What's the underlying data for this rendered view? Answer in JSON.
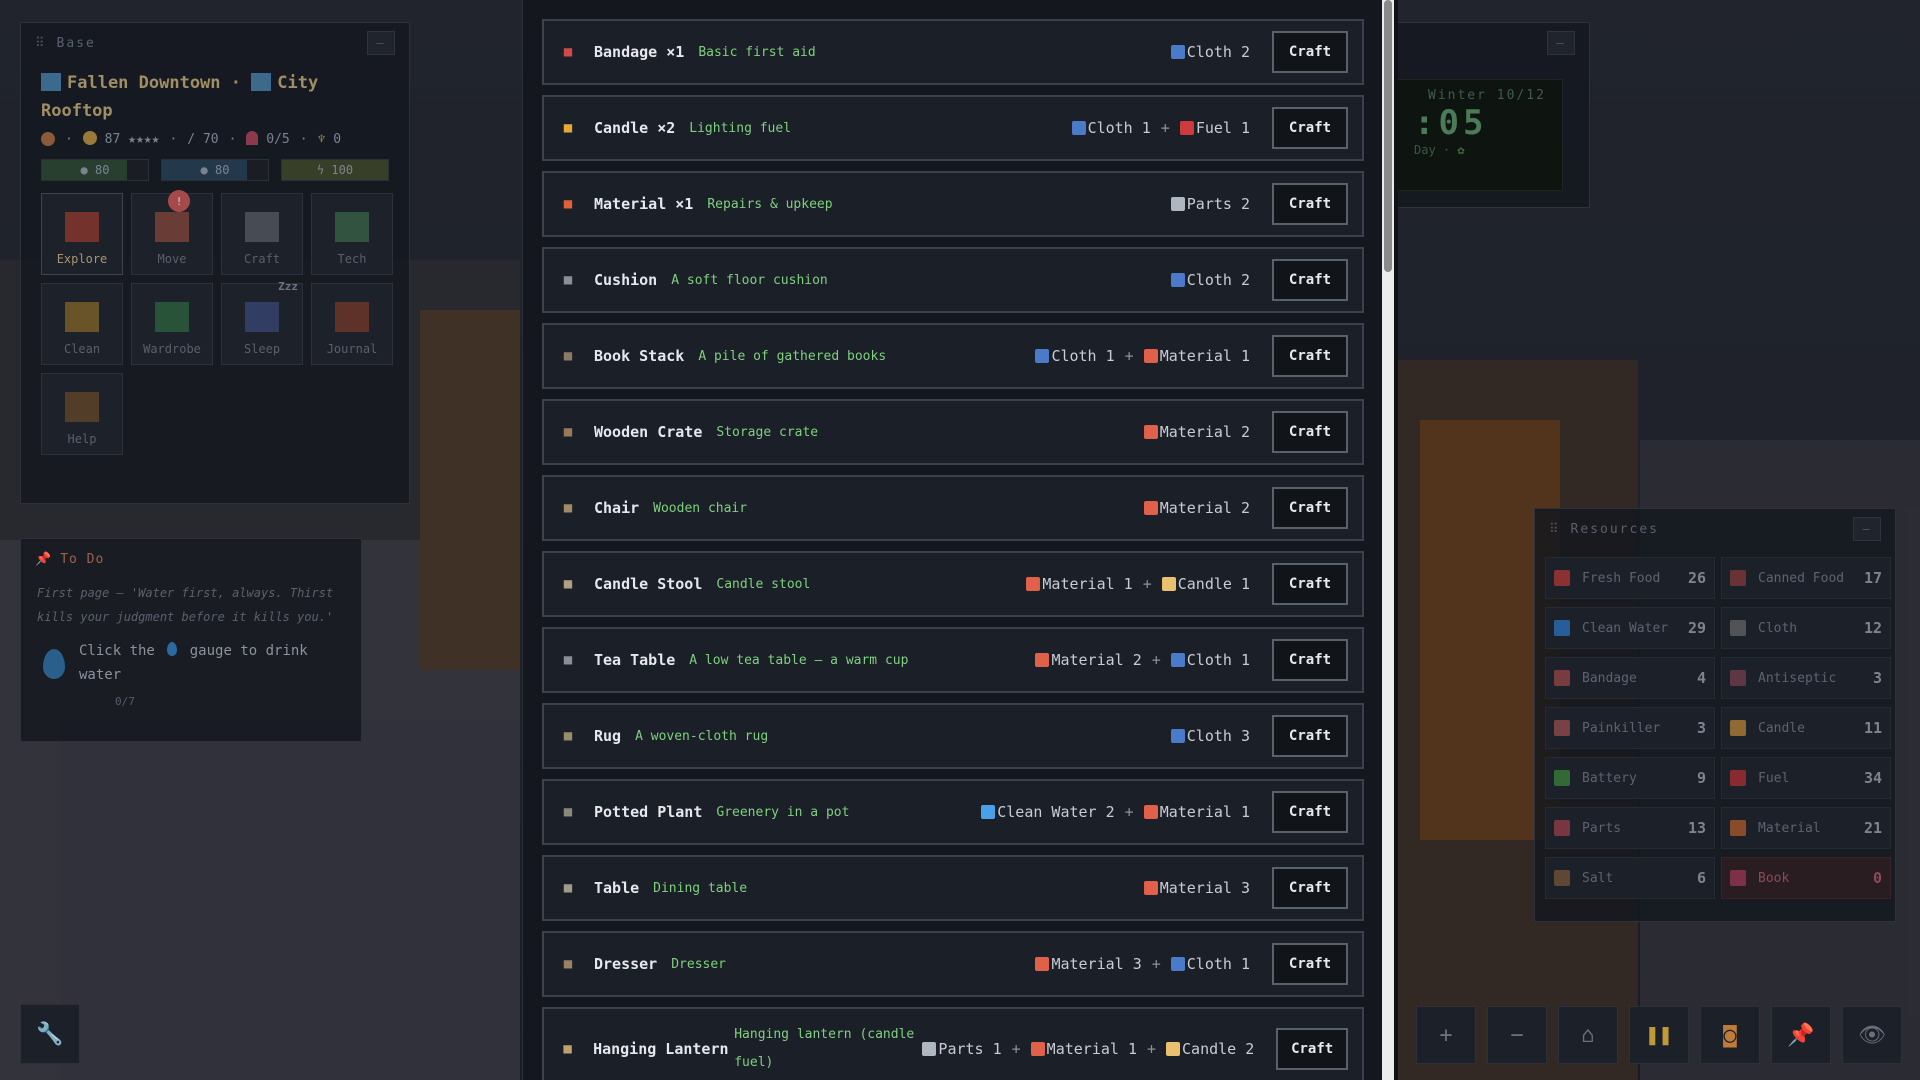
{
  "base": {
    "title": "Base",
    "minimize": "–",
    "location_line1": "Fallen Downtown · ",
    "location_city": "City",
    "location_line2": "Rooftop",
    "stats": {
      "food_sep": "·",
      "mood": "87",
      "stars": "★★★★",
      "sep": "·",
      "attack": "70",
      "capacity": "0/5",
      "trophy": "0"
    },
    "bars": [
      {
        "value": "80",
        "level": 0.8,
        "color": "#3a6a3e"
      },
      {
        "value": "80",
        "level": 0.8,
        "color": "#2f5a7a"
      },
      {
        "value": "100",
        "level": 1.0,
        "color": "#5a6a2e"
      }
    ],
    "tiles": [
      {
        "label": "Explore",
        "icon": "explore-icon"
      },
      {
        "label": "Move",
        "icon": "move-icon",
        "badge": "!"
      },
      {
        "label": "Craft",
        "icon": "craft-icon"
      },
      {
        "label": "Tech",
        "icon": "tech-icon"
      },
      {
        "label": "Clean",
        "icon": "clean-icon"
      },
      {
        "label": "Wardrobe",
        "icon": "wardrobe-icon"
      },
      {
        "label": "Sleep",
        "icon": "sleep-icon",
        "zzz": "Zzz"
      },
      {
        "label": "Journal",
        "icon": "journal-icon"
      },
      {
        "label": "Help",
        "icon": "help-icon"
      }
    ]
  },
  "todo": {
    "title": "To Do",
    "quote": "First page — 'Water first, always. Thirst kills your judgment before it kills you.'",
    "task_a": "Click the",
    "task_b": "gauge to drink water",
    "progress": "0/7"
  },
  "clock": {
    "minimize": "–",
    "season": "Winter 10/12",
    "time": ":05",
    "day": "Day · "
  },
  "resources": {
    "title": "Resources",
    "minimize": "–",
    "items": [
      {
        "name": "Fresh Food",
        "value": "26",
        "color": "#b83a34"
      },
      {
        "name": "Canned Food",
        "value": "17",
        "color": "#8a3a3a"
      },
      {
        "name": "Clean Water",
        "value": "29",
        "color": "#2c78c8"
      },
      {
        "name": "Cloth",
        "value": "12",
        "color": "#6a6a6a"
      },
      {
        "name": "Bandage",
        "value": "4",
        "color": "#a04848"
      },
      {
        "name": "Antiseptic",
        "value": "3",
        "color": "#7a4050"
      },
      {
        "name": "Painkiller",
        "value": "3",
        "color": "#a05050"
      },
      {
        "name": "Candle",
        "value": "11",
        "color": "#c08a3a"
      },
      {
        "name": "Battery",
        "value": "9",
        "color": "#3a8a3a"
      },
      {
        "name": "Fuel",
        "value": "34",
        "color": "#b83030"
      },
      {
        "name": "Parts",
        "value": "13",
        "color": "#a0404a"
      },
      {
        "name": "Material",
        "value": "21",
        "color": "#b8602a"
      },
      {
        "name": "Salt",
        "value": "6",
        "color": "#7a5a3a"
      },
      {
        "name": "Book",
        "value": "0",
        "color": "#a03a5a",
        "warn": true
      }
    ]
  },
  "toolbar": {
    "wrench": "🔧",
    "zoom_in": "+",
    "zoom_out": "−",
    "home": "⌂",
    "pause": "❚❚",
    "robot": "◙",
    "pin": "📌",
    "eye": "👁"
  },
  "crafting": {
    "button_label": "Craft",
    "plus": "+",
    "recipes": [
      {
        "name": "Bandage ×1",
        "desc": "Basic first aid",
        "icon_color": "#d04a4a",
        "costs": [
          {
            "label": "Cloth 2",
            "color": "#4a7ac8"
          }
        ]
      },
      {
        "name": "Candle ×2",
        "desc": "Lighting fuel",
        "icon_color": "#e8a83a",
        "costs": [
          {
            "label": "Cloth 1",
            "color": "#4a7ac8"
          },
          {
            "label": "Fuel 1",
            "color": "#d03a3a"
          }
        ]
      },
      {
        "name": "Material ×1",
        "desc": "Repairs & upkeep",
        "icon_color": "#e0603a",
        "costs": [
          {
            "label": "Parts 2",
            "color": "#b0b6c0"
          }
        ]
      },
      {
        "name": "Cushion",
        "desc": "A soft floor cushion",
        "icon_color": "#8a8e96",
        "costs": [
          {
            "label": "Cloth 2",
            "color": "#4a7ac8"
          }
        ]
      },
      {
        "name": "Book Stack",
        "desc": "A pile of gathered books",
        "icon_color": "#8a7a66",
        "costs": [
          {
            "label": "Cloth 1",
            "color": "#4a7ac8"
          },
          {
            "label": "Material 1",
            "color": "#e0604a"
          }
        ]
      },
      {
        "name": "Wooden Crate",
        "desc": "Storage crate",
        "icon_color": "#9a7a56",
        "costs": [
          {
            "label": "Material 2",
            "color": "#e0604a"
          }
        ]
      },
      {
        "name": "Chair",
        "desc": "Wooden chair",
        "icon_color": "#a08a66",
        "costs": [
          {
            "label": "Material 2",
            "color": "#e0604a"
          }
        ]
      },
      {
        "name": "Candle Stool",
        "desc": "Candle stool",
        "icon_color": "#b0a080",
        "costs": [
          {
            "label": "Material 1",
            "color": "#e0604a"
          },
          {
            "label": "Candle 1",
            "color": "#e8c070"
          }
        ]
      },
      {
        "name": "Tea Table",
        "desc": "A low tea table — a warm cup",
        "icon_color": "#8a8e96",
        "costs": [
          {
            "label": "Material 2",
            "color": "#e0604a"
          },
          {
            "label": "Cloth 1",
            "color": "#4a7ac8"
          }
        ]
      },
      {
        "name": "Rug",
        "desc": "A woven-cloth rug",
        "icon_color": "#9a8a6a",
        "costs": [
          {
            "label": "Cloth 3",
            "color": "#4a7ac8"
          }
        ]
      },
      {
        "name": "Potted Plant",
        "desc": "Greenery in a pot",
        "icon_color": "#8a8a7a",
        "costs": [
          {
            "label": "Clean Water 2",
            "color": "#4aa0e8"
          },
          {
            "label": "Material 1",
            "color": "#e0604a"
          }
        ]
      },
      {
        "name": "Table",
        "desc": "Dining table",
        "icon_color": "#a09a8a",
        "costs": [
          {
            "label": "Material 3",
            "color": "#e0604a"
          }
        ]
      },
      {
        "name": "Dresser",
        "desc": "Dresser",
        "icon_color": "#9a8066",
        "costs": [
          {
            "label": "Material 3",
            "color": "#e0604a"
          },
          {
            "label": "Cloth 1",
            "color": "#4a7ac8"
          }
        ]
      },
      {
        "name": "Hanging Lantern",
        "desc": "Hanging lantern (candle fuel)",
        "icon_color": "#c0a070",
        "tall": true,
        "costs": [
          {
            "label": "Parts 1",
            "color": "#b0b6c0"
          },
          {
            "label": "Material 1",
            "color": "#e0604a"
          },
          {
            "label": "Candle 2",
            "color": "#e8c070"
          }
        ]
      }
    ]
  }
}
